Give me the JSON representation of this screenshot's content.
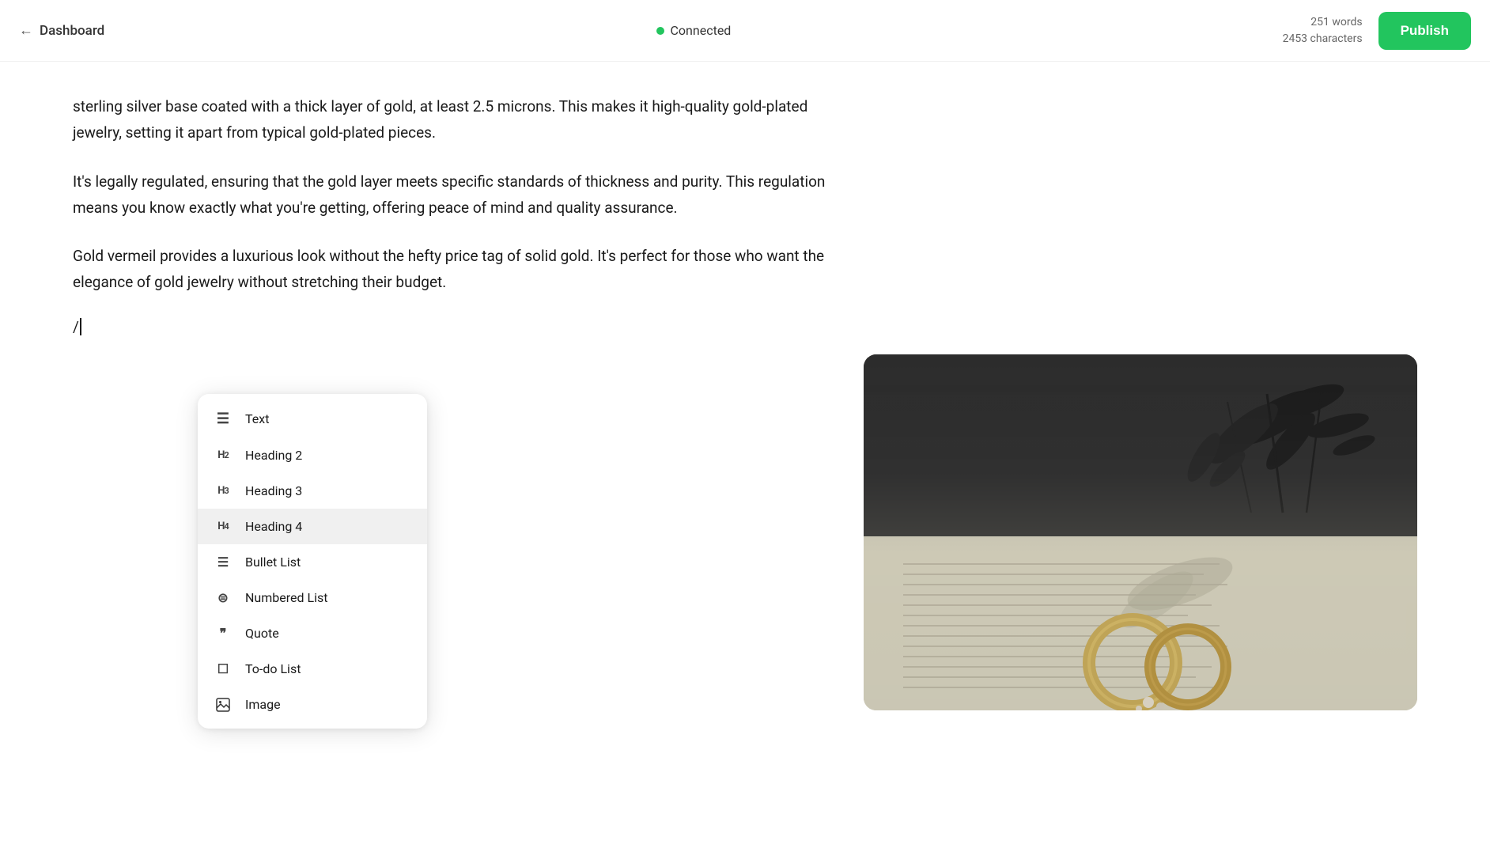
{
  "header": {
    "back_label": "Dashboard",
    "connection_status": "Connected",
    "word_count_line1": "251 words",
    "word_count_line2": "2453 characters",
    "publish_label": "Publish",
    "colors": {
      "connected_dot": "#22c55e",
      "publish_bg": "#22c55e"
    }
  },
  "editor": {
    "paragraph1": "sterling silver base coated with a thick layer of gold, at least 2.5 microns. This makes it high-quality gold-plated jewelry, setting it apart from typical gold-plated pieces.",
    "paragraph2": "It's legally regulated, ensuring that the gold layer meets specific standards of thickness and purity. This regulation means you know exactly what you're getting, offering peace of mind and quality assurance.",
    "paragraph3": "Gold vermeil provides a luxurious look without the hefty price tag of solid gold. It's perfect for those who want the elegance of gold jewelry without stretching their budget.",
    "cursor_char": "/"
  },
  "slash_menu": {
    "items": [
      {
        "id": "text",
        "icon": "≡",
        "label": "Text"
      },
      {
        "id": "heading2",
        "icon": "H₂",
        "label": "Heading 2"
      },
      {
        "id": "heading3",
        "icon": "H₃",
        "label": "Heading 3"
      },
      {
        "id": "heading4",
        "icon": "H₄",
        "label": "Heading 4"
      },
      {
        "id": "bullet-list",
        "icon": "≡",
        "label": "Bullet List"
      },
      {
        "id": "numbered-list",
        "icon": "≔",
        "label": "Numbered List"
      },
      {
        "id": "quote",
        "icon": "❝",
        "label": "Quote"
      },
      {
        "id": "todo-list",
        "icon": "☐",
        "label": "To-do List"
      },
      {
        "id": "image",
        "icon": "⊡",
        "label": "Image"
      }
    ],
    "highlighted_item": "heading"
  }
}
